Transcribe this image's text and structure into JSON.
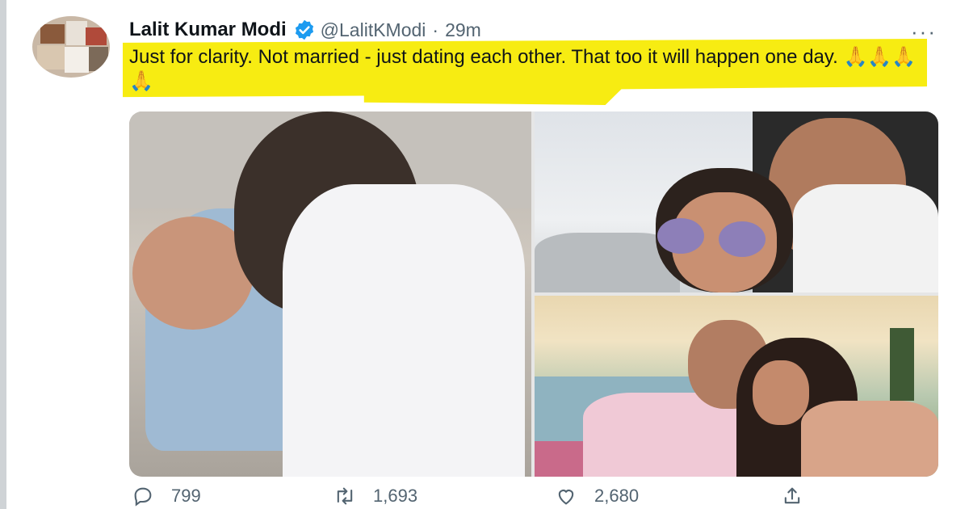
{
  "tweet": {
    "author_name": "Lalit Kumar Modi",
    "handle": "@LalitKModi",
    "separator": "·",
    "time": "29m",
    "more_label": "···",
    "text": "Just for clarity. Not married - just dating each other. That too it will happen one day. 🙏🙏🙏🙏",
    "highlight_color": "#f7ec12",
    "verified_color": "#1d9bf0"
  },
  "actions": {
    "reply_count": "799",
    "retweet_count": "1,693",
    "like_count": "2,680",
    "icons": [
      "reply-icon",
      "retweet-icon",
      "like-icon",
      "share-icon"
    ]
  }
}
